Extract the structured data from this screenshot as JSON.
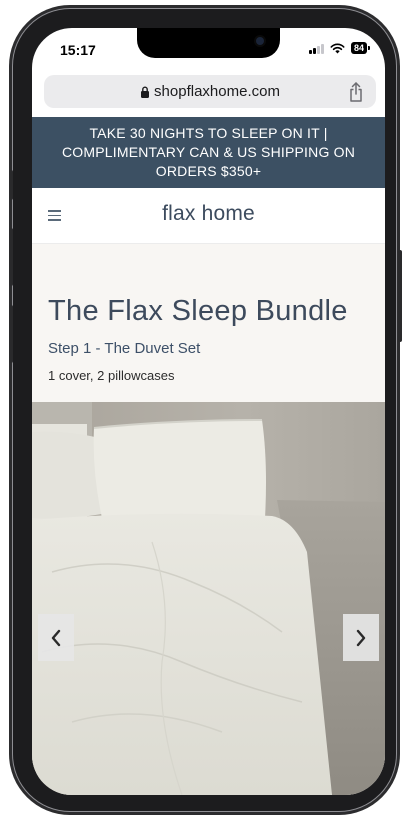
{
  "status_bar": {
    "time": "15:17",
    "battery_level": "84",
    "icons": [
      "signal-icon",
      "wifi-icon",
      "battery-icon"
    ]
  },
  "browser": {
    "url": "shopflaxhome.com",
    "icons": [
      "lock-icon",
      "share-icon"
    ]
  },
  "banner": {
    "text": "TAKE 30 NIGHTS TO SLEEP ON IT | COMPLIMENTARY CAN & US SHIPPING ON ORDERS $350+",
    "background": "#3c5063"
  },
  "header": {
    "logo": "flax home",
    "icons": [
      "menu-icon"
    ]
  },
  "product": {
    "title": "The Flax Sleep Bundle",
    "step": "Step 1 - The Duvet Set",
    "description": "1 cover, 2 pillowcases"
  },
  "gallery": {
    "icons": [
      "chevron-left-icon",
      "chevron-right-icon"
    ]
  },
  "colors": {
    "brand_slate": "#3c5063",
    "heading": "#3d4a5c",
    "page_bg": "#f8f6f3"
  }
}
